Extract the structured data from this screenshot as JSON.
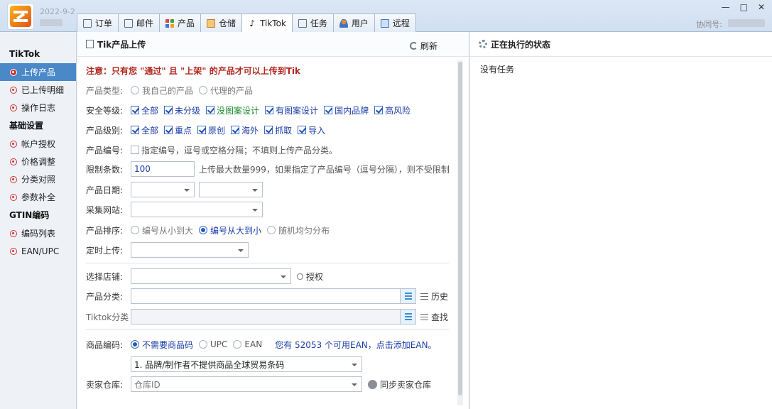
{
  "header": {
    "date": "2022-9-2",
    "tabs": [
      {
        "label": "订单",
        "icon": "document-icon"
      },
      {
        "label": "邮件",
        "icon": "mail-icon"
      },
      {
        "label": "产品",
        "icon": "grid-icon"
      },
      {
        "label": "仓储",
        "icon": "box-icon"
      },
      {
        "label": "TikTok",
        "icon": "tiktok-icon",
        "glyph": "♪"
      },
      {
        "label": "任务",
        "icon": "task-icon"
      },
      {
        "label": "用户",
        "icon": "user-icon"
      },
      {
        "label": "远程",
        "icon": "remote-icon"
      }
    ],
    "window": {
      "minimize": "—",
      "maximize": "□",
      "close": "✕"
    },
    "assist_label": "协同号:"
  },
  "sidebar": {
    "sections": [
      {
        "title": "TikTok",
        "items": [
          "上传产品",
          "已上传明细",
          "操作日志"
        ]
      },
      {
        "title": "基础设置",
        "items": [
          "帐户授权",
          "价格调整",
          "分类对照",
          "参数补全"
        ]
      },
      {
        "title": "GTIN编码",
        "items": [
          "编码列表",
          "EAN/UPC"
        ]
      }
    ],
    "active": "上传产品"
  },
  "main": {
    "title": "Tik产品上传",
    "refresh_label": "刷新",
    "notice": "注意：只有您 \"通过\" 且 \"上架\" 的产品才可以上传到Tik",
    "product_type": {
      "label": "产品类型:",
      "options": [
        "我自己的产品",
        "代理的产品"
      ]
    },
    "safety": {
      "label": "安全等级:",
      "options": [
        "全部",
        "未分级",
        "没图案设计",
        "有图案设计",
        "国内品牌",
        "高风险"
      ]
    },
    "level": {
      "label": "产品级别:",
      "options": [
        "全部",
        "重点",
        "原创",
        "海外",
        "抓取",
        "导入"
      ]
    },
    "code": {
      "label": "产品编号:",
      "check_label": "指定编号，逗号或空格分隔；不填则上传产品分类。"
    },
    "limit": {
      "label": "限制条数:",
      "value": "100",
      "hint": "上传最大数量999，如果指定了产品编号（逗号分隔），则不受限制"
    },
    "date": {
      "label": "产品日期:"
    },
    "site": {
      "label": "采集网站:"
    },
    "sort": {
      "label": "产品排序:",
      "options": [
        "编号从小到大",
        "编号从大到小",
        "随机均匀分布"
      ],
      "selected": "编号从大到小"
    },
    "timer": {
      "label": "定时上传:"
    },
    "shop": {
      "label": "选择店铺:",
      "auth_label": "授权"
    },
    "category": {
      "label": "产品分类:",
      "history_label": "历史"
    },
    "tiktok_category": {
      "label": "Tiktok分类",
      "search_label": "查找"
    },
    "barcode": {
      "label": "商品编码:",
      "options": [
        "不需要商品码",
        "UPC",
        "EAN"
      ],
      "selected": "不需要商品码",
      "info": "您有 52053 个可用EAN，点击添加EAN。"
    },
    "brand_select": {
      "value": "1. 品牌/制作者不提供商品全球贸易条码"
    },
    "warehouse": {
      "label": "卖家仓库:",
      "placeholder": "仓库ID",
      "sync_label": "同步卖家仓库"
    }
  },
  "right": {
    "title": "正在执行的状态",
    "status": "没有任务"
  }
}
